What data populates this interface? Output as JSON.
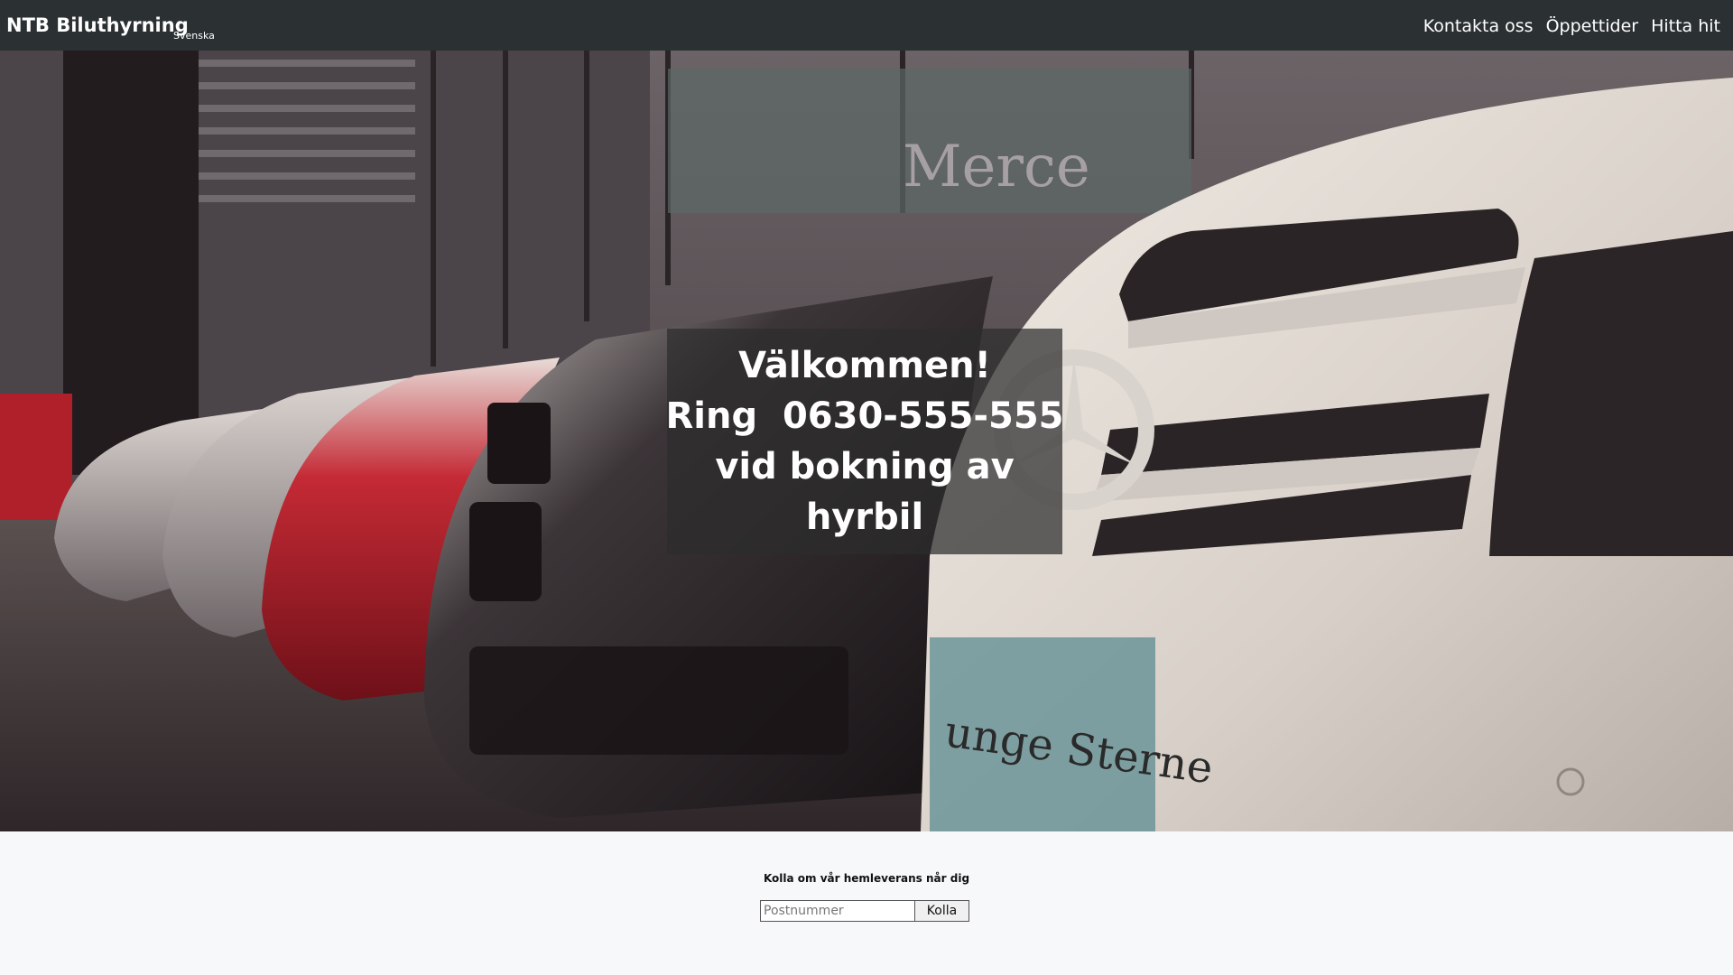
{
  "navbar": {
    "brand": "NTB Biluthyrning",
    "language": "Svenska",
    "links": [
      {
        "label": "Kontakta oss"
      },
      {
        "label": "Öppettider"
      },
      {
        "label": "Hitta hit"
      }
    ]
  },
  "hero": {
    "image_description_icon": "car-lineup-photo",
    "welcome_lines": [
      "Välkommen!",
      "Ring  0630-555-555",
      "vid bokning av",
      "hyrbil"
    ]
  },
  "delivery_check": {
    "label": "Kolla om vår hemleverans når dig",
    "input_value": "",
    "input_placeholder": "Postnummer",
    "button_label": "Kolla"
  },
  "colors": {
    "navbar_bg": "#2b3032",
    "overlay_bg": "#2d2d2d",
    "page_bg": "#f7f8f9"
  }
}
